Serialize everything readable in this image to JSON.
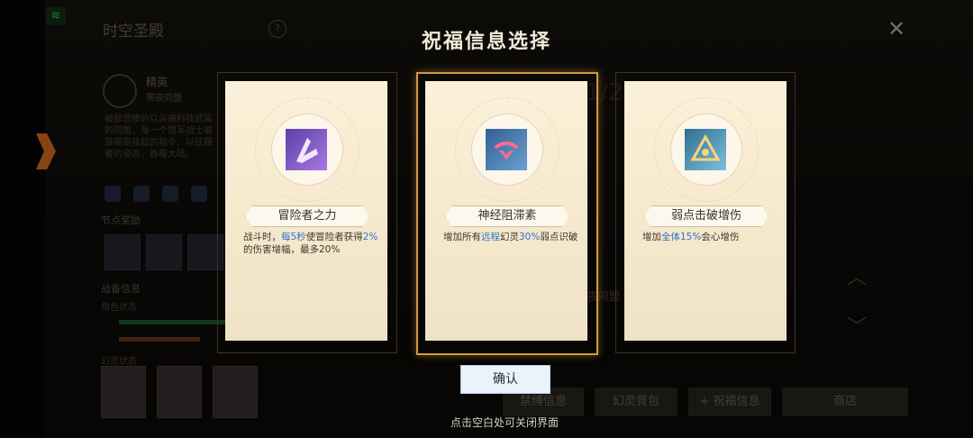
{
  "background": {
    "title": "时空圣殿",
    "help": "?",
    "close": "✕",
    "elite": "精英",
    "elite_sub": "霁夜同盟",
    "desc": "被那悲惨的以尖端科技武装的同盟，每一个盟军战士被浪高高挂起的指令，以征服者的姿态，吞噬大陆。",
    "node_reward": "节点奖励",
    "battle_info": "战备信息",
    "role_status": "角色状态",
    "spirit_status": "幻灵状态",
    "count": "1/2",
    "night": "夜同盟",
    "up": "︿",
    "down": "﹀",
    "tabs": [
      "禁缚信息",
      "幻灵背包",
      "+ 祝福信息",
      "商店"
    ]
  },
  "modal": {
    "title": "祝福信息选择",
    "cards": [
      {
        "name": "冒险者之力",
        "icon": "adventurer-power-icon",
        "desc": [
          "战斗时，",
          "每5秒",
          "使冒险者获得",
          "2%",
          "的伤害增幅，最多20%"
        ]
      },
      {
        "name": "神经阻滞素",
        "icon": "neural-block-icon",
        "desc": [
          "增加所有",
          "远程",
          "幻灵",
          "30%",
          "弱点识破"
        ]
      },
      {
        "name": "弱点击破增伤",
        "icon": "weakpoint-break-icon",
        "desc": [
          "增加",
          "全体15%",
          "会心增伤"
        ]
      }
    ],
    "confirm_label": "确认",
    "hint": "点击空白处可关闭界面"
  },
  "colors": {
    "accent": "#d29a3a",
    "highlight": "#2f72c8",
    "card_bg": "#f6e8cc"
  }
}
